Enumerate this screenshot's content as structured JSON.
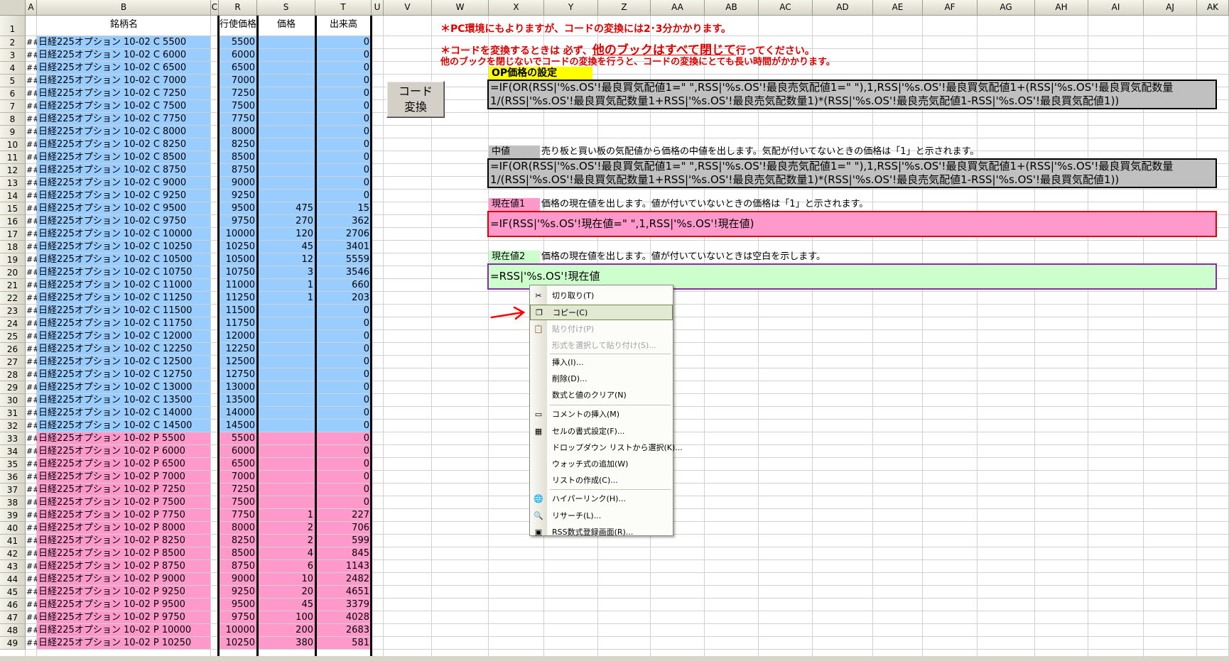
{
  "columns": [
    {
      "label": "A"
    },
    {
      "label": "B"
    },
    {
      "label": "C"
    },
    {
      "label": "R"
    },
    {
      "label": "S"
    },
    {
      "label": "T"
    },
    {
      "label": "U"
    },
    {
      "label": "V"
    },
    {
      "label": "W"
    },
    {
      "label": "X"
    },
    {
      "label": "Y"
    },
    {
      "label": "Z"
    },
    {
      "label": "AA"
    },
    {
      "label": "AB"
    },
    {
      "label": "AC"
    },
    {
      "label": "AD"
    },
    {
      "label": "AE"
    },
    {
      "label": "AF"
    },
    {
      "label": "AG"
    },
    {
      "label": "AH"
    },
    {
      "label": "AI"
    },
    {
      "label": "AJ"
    },
    {
      "label": "AK"
    }
  ],
  "header_row": {
    "row": "1",
    "name": "銘柄名",
    "strike": "行使価格",
    "price": "価格",
    "volume": "出来高"
  },
  "rows": [
    {
      "row": "2",
      "a": "##",
      "name": "日経225オプション 10-02 C 5500",
      "strike": "5500",
      "price": "",
      "volume": "0",
      "type": "call"
    },
    {
      "row": "3",
      "a": "##",
      "name": "日経225オプション 10-02 C 6000",
      "strike": "6000",
      "price": "",
      "volume": "0",
      "type": "call"
    },
    {
      "row": "4",
      "a": "##",
      "name": "日経225オプション 10-02 C 6500",
      "strike": "6500",
      "price": "",
      "volume": "0",
      "type": "call"
    },
    {
      "row": "5",
      "a": "##",
      "name": "日経225オプション 10-02 C 7000",
      "strike": "7000",
      "price": "",
      "volume": "0",
      "type": "call"
    },
    {
      "row": "6",
      "a": "##",
      "name": "日経225オプション 10-02 C 7250",
      "strike": "7250",
      "price": "",
      "volume": "0",
      "type": "call"
    },
    {
      "row": "7",
      "a": "##",
      "name": "日経225オプション 10-02 C 7500",
      "strike": "7500",
      "price": "",
      "volume": "0",
      "type": "call"
    },
    {
      "row": "8",
      "a": "##",
      "name": "日経225オプション 10-02 C 7750",
      "strike": "7750",
      "price": "",
      "volume": "0",
      "type": "call"
    },
    {
      "row": "9",
      "a": "##",
      "name": "日経225オプション 10-02 C 8000",
      "strike": "8000",
      "price": "",
      "volume": "0",
      "type": "call"
    },
    {
      "row": "10",
      "a": "##",
      "name": "日経225オプション 10-02 C 8250",
      "strike": "8250",
      "price": "",
      "volume": "0",
      "type": "call"
    },
    {
      "row": "11",
      "a": "##",
      "name": "日経225オプション 10-02 C 8500",
      "strike": "8500",
      "price": "",
      "volume": "0",
      "type": "call"
    },
    {
      "row": "12",
      "a": "##",
      "name": "日経225オプション 10-02 C 8750",
      "strike": "8750",
      "price": "",
      "volume": "0",
      "type": "call"
    },
    {
      "row": "13",
      "a": "##",
      "name": "日経225オプション 10-02 C 9000",
      "strike": "9000",
      "price": "",
      "volume": "0",
      "type": "call"
    },
    {
      "row": "14",
      "a": "##",
      "name": "日経225オプション 10-02 C 9250",
      "strike": "9250",
      "price": "",
      "volume": "0",
      "type": "call"
    },
    {
      "row": "15",
      "a": "##",
      "name": "日経225オプション 10-02 C 9500",
      "strike": "9500",
      "price": "475",
      "volume": "15",
      "type": "call"
    },
    {
      "row": "16",
      "a": "##",
      "name": "日経225オプション 10-02 C 9750",
      "strike": "9750",
      "price": "270",
      "volume": "362",
      "type": "call"
    },
    {
      "row": "17",
      "a": "##",
      "name": "日経225オプション 10-02 C 10000",
      "strike": "10000",
      "price": "120",
      "volume": "2706",
      "type": "call"
    },
    {
      "row": "18",
      "a": "##",
      "name": "日経225オプション 10-02 C 10250",
      "strike": "10250",
      "price": "45",
      "volume": "3401",
      "type": "call"
    },
    {
      "row": "19",
      "a": "##",
      "name": "日経225オプション 10-02 C 10500",
      "strike": "10500",
      "price": "12",
      "volume": "5559",
      "type": "call"
    },
    {
      "row": "20",
      "a": "##",
      "name": "日経225オプション 10-02 C 10750",
      "strike": "10750",
      "price": "3",
      "volume": "3546",
      "type": "call"
    },
    {
      "row": "21",
      "a": "##",
      "name": "日経225オプション 10-02 C 11000",
      "strike": "11000",
      "price": "1",
      "volume": "660",
      "type": "call"
    },
    {
      "row": "22",
      "a": "##",
      "name": "日経225オプション 10-02 C 11250",
      "strike": "11250",
      "price": "1",
      "volume": "203",
      "type": "call"
    },
    {
      "row": "23",
      "a": "##",
      "name": "日経225オプション 10-02 C 11500",
      "strike": "11500",
      "price": "",
      "volume": "0",
      "type": "call"
    },
    {
      "row": "24",
      "a": "##",
      "name": "日経225オプション 10-02 C 11750",
      "strike": "11750",
      "price": "",
      "volume": "0",
      "type": "call"
    },
    {
      "row": "25",
      "a": "##",
      "name": "日経225オプション 10-02 C 12000",
      "strike": "12000",
      "price": "",
      "volume": "0",
      "type": "call"
    },
    {
      "row": "26",
      "a": "##",
      "name": "日経225オプション 10-02 C 12250",
      "strike": "12250",
      "price": "",
      "volume": "0",
      "type": "call"
    },
    {
      "row": "27",
      "a": "##",
      "name": "日経225オプション 10-02 C 12500",
      "strike": "12500",
      "price": "",
      "volume": "0",
      "type": "call"
    },
    {
      "row": "28",
      "a": "##",
      "name": "日経225オプション 10-02 C 12750",
      "strike": "12750",
      "price": "",
      "volume": "0",
      "type": "call"
    },
    {
      "row": "29",
      "a": "##",
      "name": "日経225オプション 10-02 C 13000",
      "strike": "13000",
      "price": "",
      "volume": "0",
      "type": "call"
    },
    {
      "row": "30",
      "a": "##",
      "name": "日経225オプション 10-02 C 13500",
      "strike": "13500",
      "price": "",
      "volume": "0",
      "type": "call"
    },
    {
      "row": "31",
      "a": "##",
      "name": "日経225オプション 10-02 C 14000",
      "strike": "14000",
      "price": "",
      "volume": "0",
      "type": "call"
    },
    {
      "row": "32",
      "a": "##",
      "name": "日経225オプション 10-02 C 14500",
      "strike": "14500",
      "price": "",
      "volume": "0",
      "type": "call"
    },
    {
      "row": "33",
      "a": "##",
      "name": "日経225オプション 10-02 P 5500",
      "strike": "5500",
      "price": "",
      "volume": "0",
      "type": "put"
    },
    {
      "row": "34",
      "a": "##",
      "name": "日経225オプション 10-02 P 6000",
      "strike": "6000",
      "price": "",
      "volume": "0",
      "type": "put"
    },
    {
      "row": "35",
      "a": "##",
      "name": "日経225オプション 10-02 P 6500",
      "strike": "6500",
      "price": "",
      "volume": "0",
      "type": "put"
    },
    {
      "row": "36",
      "a": "##",
      "name": "日経225オプション 10-02 P 7000",
      "strike": "7000",
      "price": "",
      "volume": "0",
      "type": "put"
    },
    {
      "row": "37",
      "a": "##",
      "name": "日経225オプション 10-02 P 7250",
      "strike": "7250",
      "price": "",
      "volume": "0",
      "type": "put"
    },
    {
      "row": "38",
      "a": "##",
      "name": "日経225オプション 10-02 P 7500",
      "strike": "7500",
      "price": "",
      "volume": "0",
      "type": "put"
    },
    {
      "row": "39",
      "a": "##",
      "name": "日経225オプション 10-02 P 7750",
      "strike": "7750",
      "price": "1",
      "volume": "227",
      "type": "put"
    },
    {
      "row": "40",
      "a": "##",
      "name": "日経225オプション 10-02 P 8000",
      "strike": "8000",
      "price": "2",
      "volume": "706",
      "type": "put"
    },
    {
      "row": "41",
      "a": "##",
      "name": "日経225オプション 10-02 P 8250",
      "strike": "8250",
      "price": "2",
      "volume": "599",
      "type": "put"
    },
    {
      "row": "42",
      "a": "##",
      "name": "日経225オプション 10-02 P 8500",
      "strike": "8500",
      "price": "4",
      "volume": "845",
      "type": "put"
    },
    {
      "row": "43",
      "a": "##",
      "name": "日経225オプション 10-02 P 8750",
      "strike": "8750",
      "price": "6",
      "volume": "1143",
      "type": "put"
    },
    {
      "row": "44",
      "a": "##",
      "name": "日経225オプション 10-02 P 9000",
      "strike": "9000",
      "price": "10",
      "volume": "2482",
      "type": "put"
    },
    {
      "row": "45",
      "a": "##",
      "name": "日経225オプション 10-02 P 9250",
      "strike": "9250",
      "price": "20",
      "volume": "4651",
      "type": "put"
    },
    {
      "row": "46",
      "a": "##",
      "name": "日経225オプション 10-02 P 9500",
      "strike": "9500",
      "price": "45",
      "volume": "3379",
      "type": "put"
    },
    {
      "row": "47",
      "a": "##",
      "name": "日経225オプション 10-02 P 9750",
      "strike": "9750",
      "price": "100",
      "volume": "4028",
      "type": "put"
    },
    {
      "row": "48",
      "a": "##",
      "name": "日経225オプション 10-02 P 10000",
      "strike": "10000",
      "price": "200",
      "volume": "2683",
      "type": "put"
    },
    {
      "row": "49",
      "a": "##",
      "name": "日経225オプション 10-02 P 10250",
      "strike": "10250",
      "price": "380",
      "volume": "581",
      "type": "put"
    }
  ],
  "notes": {
    "note1": "＊PC環境にもよりますが、コードの変換には2･3分かかります。",
    "note2_pre": "＊コードを変換するときは 必ず、",
    "note2_emph": "他のブックはすべて閉じて",
    "note2_post": "行ってください。",
    "note3": "他のブックを閉じないでコードの変換を行うと、コードの変換にとても長い時間がかかります。"
  },
  "convert_button": {
    "line1": "コード",
    "line2": "変換"
  },
  "op_setting": {
    "title": "OP価格の設定",
    "formula_line1": "=IF(OR(RSS|'%s.OS'!最良買気配値1=\" \",RSS|'%s.OS'!最良売気配値1=\" \"),1,RSS|'%s.OS'!最良買気配値1+(RSS|'%s.OS'!最良買気配数量",
    "formula_line2": "1/(RSS|'%s.OS'!最良買気配数量1+RSS|'%s.OS'!最良売気配数量1)*(RSS|'%s.OS'!最良売気配値1-RSS|'%s.OS'!最良買気配値1))"
  },
  "mid": {
    "label": "中値",
    "description": "売り板と買い板の気配値から価格の中値を出します。気配が付いてないときの価格は「1」と示されます。",
    "formula_line1": "=IF(OR(RSS|'%s.OS'!最良買気配値1=\" \",RSS|'%s.OS'!最良売気配値1=\" \"),1,RSS|'%s.OS'!最良買気配値1+(RSS|'%s.OS'!最良買気配数量",
    "formula_line2": "1/(RSS|'%s.OS'!最良買気配数量1+RSS|'%s.OS'!最良売気配数量1)*(RSS|'%s.OS'!最良売気配値1-RSS|'%s.OS'!最良買気配値1))"
  },
  "current1": {
    "label": "現在値1",
    "description": "価格の現在値を出します。値が付いていないときの価格は「1」と示されます。",
    "formula": "=IF(RSS|'%s.OS'!現在値=\" \",1,RSS|'%s.OS'!現在値)"
  },
  "current2": {
    "label": "現在値2",
    "description": "価格の現在値を出します。値が付いていないときは空白を示します。",
    "formula": "=RSS|'%s.OS'!現在値"
  },
  "context_menu": {
    "items": [
      {
        "label": "切り取り(T)",
        "icon": "scissors-icon",
        "glyph": "✂",
        "disabled": false
      },
      {
        "label": "コピー(C)",
        "icon": "copy-icon",
        "glyph": "❐",
        "disabled": false
      },
      {
        "label": "貼り付け(P)",
        "icon": "paste-icon",
        "glyph": "📋",
        "disabled": true
      },
      {
        "label": "形式を選択して貼り付け(S)...",
        "icon": "",
        "glyph": "",
        "disabled": true
      },
      {
        "label": "挿入(I)...",
        "icon": "",
        "glyph": "",
        "disabled": false
      },
      {
        "label": "削除(D)...",
        "icon": "",
        "glyph": "",
        "disabled": false
      },
      {
        "label": "数式と値のクリア(N)",
        "icon": "",
        "glyph": "",
        "disabled": false
      },
      {
        "label": "コメントの挿入(M)",
        "icon": "comment-icon",
        "glyph": "▭",
        "disabled": false
      },
      {
        "label": "セルの書式設定(F)...",
        "icon": "format-cells-icon",
        "glyph": "▦",
        "disabled": false
      },
      {
        "label": "ドロップダウン リストから選択(K)...",
        "icon": "",
        "glyph": "",
        "disabled": false
      },
      {
        "label": "ウォッチ式の追加(W)",
        "icon": "",
        "glyph": "",
        "disabled": false
      },
      {
        "label": "リストの作成(C)...",
        "icon": "",
        "glyph": "",
        "disabled": false
      },
      {
        "label": "ハイパーリンク(H)...",
        "icon": "hyperlink-icon",
        "glyph": "🌐",
        "disabled": false
      },
      {
        "label": "リサーチ(L)...",
        "icon": "research-icon",
        "glyph": "🔍",
        "disabled": false
      },
      {
        "label": "RSS数式登録画面(R)...",
        "icon": "rss-form-icon",
        "glyph": "▣",
        "disabled": false
      }
    ],
    "highlighted_index": 1
  },
  "colors": {
    "call_bg": "#99ccff",
    "put_bg": "#ff99cc",
    "formula_gray": "#c0c0c0",
    "op_title_bg": "#ffff00",
    "current1_bg": "#ff99cc",
    "current2_bg": "#ccffcc",
    "note_red": "#e00000",
    "arrow_red": "#ff0000"
  }
}
